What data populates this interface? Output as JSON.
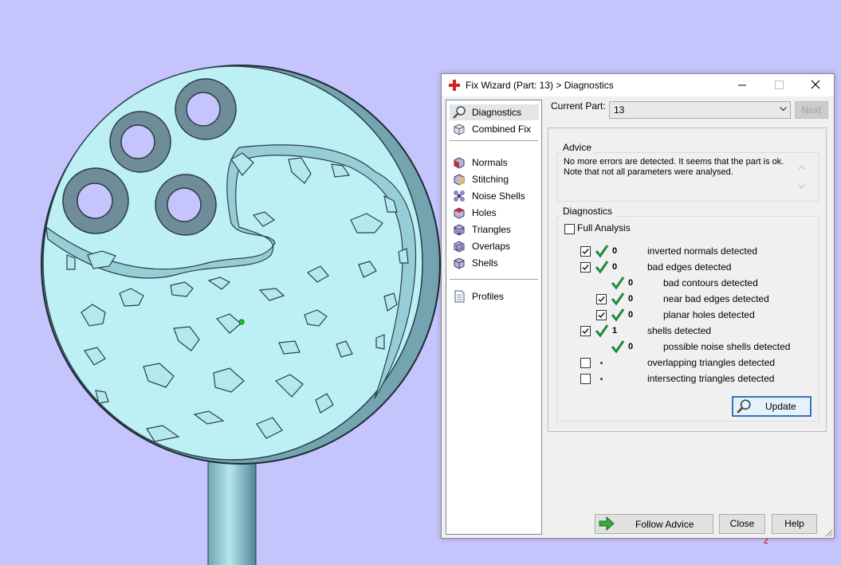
{
  "window": {
    "title": "Fix Wizard (Part: 13) > Diagnostics",
    "controls": [
      "minimize",
      "maximize",
      "close"
    ]
  },
  "nav": {
    "top": [
      {
        "label": "Diagnostics",
        "icon": "magnifier-icon",
        "selected": true
      },
      {
        "label": "Combined Fix",
        "icon": "cube-icon"
      }
    ],
    "fixes": [
      {
        "label": "Normals",
        "icon": "normals-cube-icon"
      },
      {
        "label": "Stitching",
        "icon": "stitching-cube-icon"
      },
      {
        "label": "Noise Shells",
        "icon": "noise-shells-icon"
      },
      {
        "label": "Holes",
        "icon": "holes-cube-icon"
      },
      {
        "label": "Triangles",
        "icon": "triangles-cube-icon"
      },
      {
        "label": "Overlaps",
        "icon": "overlaps-cube-icon"
      },
      {
        "label": "Shells",
        "icon": "shells-cube-icon"
      }
    ],
    "bottom": [
      {
        "label": "Profiles",
        "icon": "document-icon"
      }
    ]
  },
  "current_part": {
    "label": "Current Part:",
    "value": "13",
    "next_label": "Next"
  },
  "advice": {
    "label": "Advice",
    "text": "No more errors are detected. It seems that the part is ok.\nNote that not all parameters were analysed."
  },
  "diagnostics": {
    "label": "Diagnostics",
    "full_analysis_label": "Full Analysis",
    "full_analysis_checked": false,
    "rows": [
      {
        "checked": true,
        "status": "ok",
        "count": "0",
        "text": "inverted normals detected",
        "indent": 0
      },
      {
        "checked": true,
        "status": "ok",
        "count": "0",
        "text": "bad edges detected",
        "indent": 0
      },
      {
        "checked": null,
        "status": "ok",
        "count": "0",
        "text": "bad contours detected",
        "indent": 1
      },
      {
        "checked": true,
        "status": "ok",
        "count": "0",
        "text": "near bad edges detected",
        "indent": 1
      },
      {
        "checked": true,
        "status": "ok",
        "count": "0",
        "text": "planar holes detected",
        "indent": 1
      },
      {
        "checked": true,
        "status": "ok",
        "count": "1",
        "text": "shells detected",
        "indent": 0
      },
      {
        "checked": null,
        "status": "ok",
        "count": "0",
        "text": "possible noise shells detected",
        "indent": 1
      },
      {
        "checked": false,
        "status": "pending",
        "count": "",
        "text": "overlapping triangles detected",
        "indent": 0
      },
      {
        "checked": false,
        "status": "pending",
        "count": "",
        "text": "intersecting triangles detected",
        "indent": 0
      }
    ],
    "update_label": "Update"
  },
  "footer": {
    "follow_advice_label": "Follow Advice",
    "close_label": "Close",
    "help_label": "Help"
  },
  "colors": {
    "background": "#c6c4fd",
    "part": "#bdf0f5",
    "check_green": "#1f8a3a",
    "selection": "#e5e5e5"
  }
}
